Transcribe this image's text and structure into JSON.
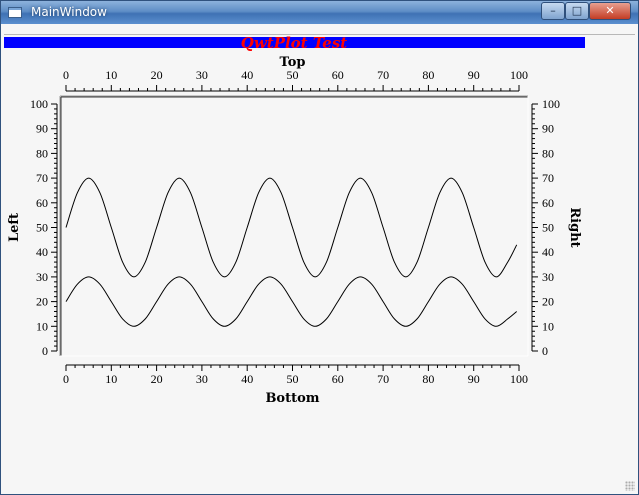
{
  "window": {
    "title": "MainWindow",
    "minimize_glyph": "–",
    "maximize_glyph": "□",
    "close_glyph": "✕"
  },
  "chart_data": {
    "type": "line",
    "title": "QwtPlot Test",
    "title_color": "#ff0000",
    "title_bar_color": "#0000ff",
    "xlabel_bottom": "Bottom",
    "xlabel_top": "Top",
    "ylabel_left": "Left",
    "ylabel_right": "Right",
    "xlim": [
      0,
      100
    ],
    "ylim": [
      0,
      100
    ],
    "x_ticks": [
      0,
      10,
      20,
      30,
      40,
      50,
      60,
      70,
      80,
      90,
      100
    ],
    "y_ticks": [
      0,
      10,
      20,
      30,
      40,
      50,
      60,
      70,
      80,
      90,
      100
    ],
    "grid": false,
    "line_color": "#000000",
    "series": [
      {
        "x": [
          0,
          2.5,
          5,
          7.5,
          10,
          12.5,
          15,
          17.5,
          20,
          22.5,
          25,
          27.5,
          30,
          32.5,
          35,
          37.5,
          40,
          42.5,
          45,
          47.5,
          50,
          52.5,
          55,
          57.5,
          60,
          62.5,
          65,
          67.5,
          70,
          72.5,
          75,
          77.5,
          80,
          82.5,
          85,
          87.5,
          90,
          92.5,
          95,
          97.5,
          99.5
        ],
        "values": [
          50,
          64,
          70,
          64,
          50,
          36,
          30,
          36,
          50,
          64,
          70,
          64,
          50,
          36,
          30,
          36,
          50,
          64,
          70,
          64,
          50,
          36,
          30,
          36,
          50,
          64,
          70,
          64,
          50,
          36,
          30,
          36,
          50,
          64,
          70,
          64,
          50,
          36,
          30,
          36,
          43
        ]
      },
      {
        "x": [
          0,
          2.5,
          5,
          7.5,
          10,
          12.5,
          15,
          17.5,
          20,
          22.5,
          25,
          27.5,
          30,
          32.5,
          35,
          37.5,
          40,
          42.5,
          45,
          47.5,
          50,
          52.5,
          55,
          57.5,
          60,
          62.5,
          65,
          67.5,
          70,
          72.5,
          75,
          77.5,
          80,
          82.5,
          85,
          87.5,
          90,
          92.5,
          95,
          97.5,
          99.5
        ],
        "values": [
          20,
          27,
          30,
          27,
          20,
          13,
          10,
          13,
          20,
          27,
          30,
          27,
          20,
          13,
          10,
          13,
          20,
          27,
          30,
          27,
          20,
          13,
          10,
          13,
          20,
          27,
          30,
          27,
          20,
          13,
          10,
          13,
          20,
          27,
          30,
          27,
          20,
          13,
          10,
          13,
          16
        ]
      }
    ]
  }
}
